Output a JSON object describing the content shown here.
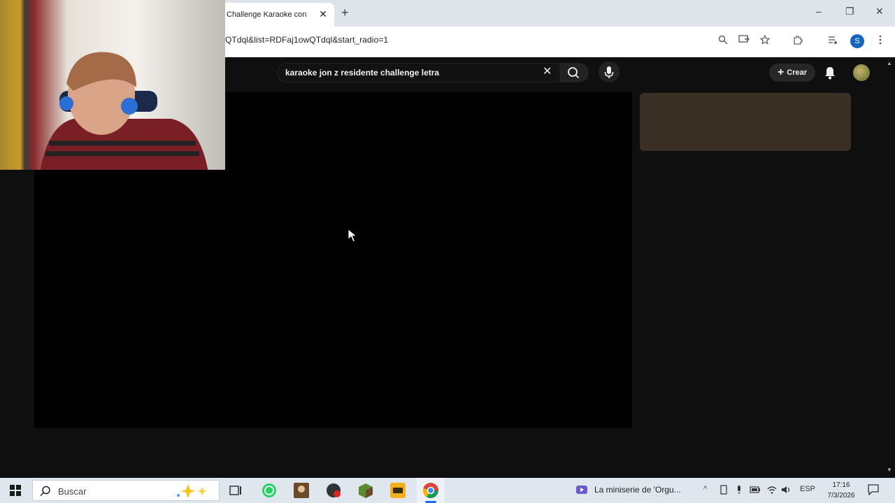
{
  "browser": {
    "tab_title": "Challenge Karaoke con",
    "tab_close": "✕",
    "new_tab": "+",
    "url": "QTdql&list=RDFaj1owQTdql&start_radio=1",
    "profile_initial": "S",
    "window_controls": {
      "minimize": "–",
      "maximize": "❐",
      "close": "✕"
    }
  },
  "youtube": {
    "search_query": "karaoke jon z residente challenge letra",
    "create_label": "Crear",
    "clear_symbol": "✕"
  },
  "taskbar": {
    "search_placeholder": "Buscar",
    "notification_text": "La miniserie de 'Orgu...",
    "language": "ESP",
    "time": "17:16",
    "date": "7/3/2026"
  },
  "colors": {
    "yt_background": "#0f0f0f",
    "side_card": "#3a2f25",
    "taskbar": "#dfe6ee"
  }
}
